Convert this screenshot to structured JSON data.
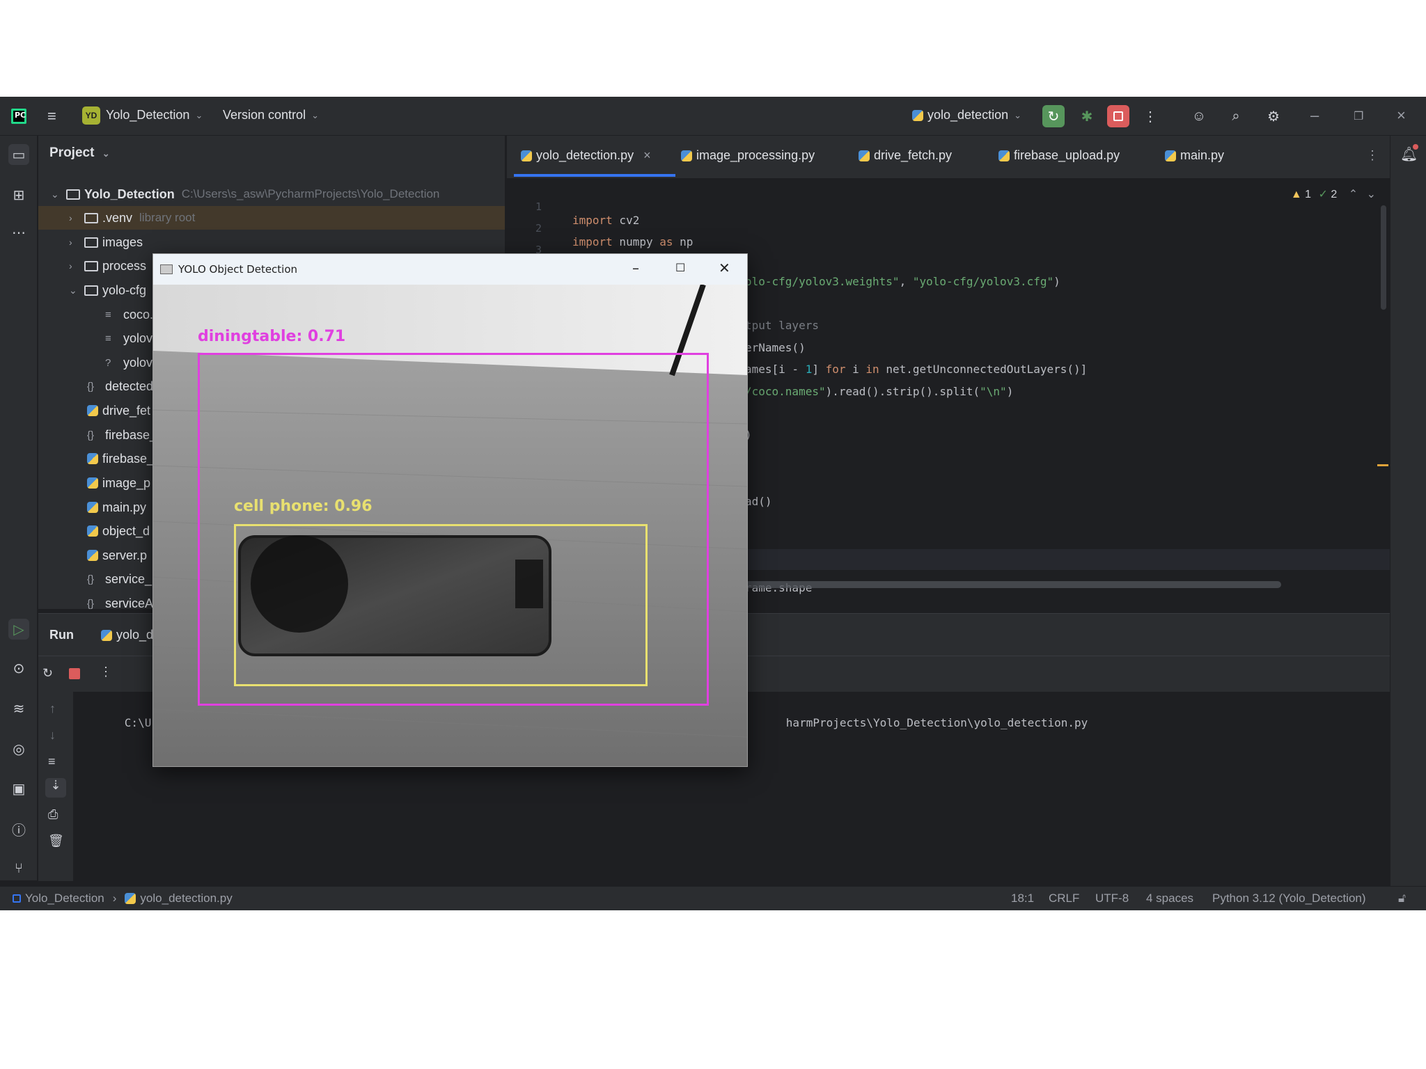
{
  "titlebar": {
    "logo": "PC",
    "project_badge": "YD",
    "project_name": "Yolo_Detection",
    "vcs_label": "Version control",
    "run_config": "yolo_detection"
  },
  "project_panel": {
    "title": "Project",
    "root": {
      "name": "Yolo_Detection",
      "path": "C:\\Users\\s_asw\\PycharmProjects\\Yolo_Detection"
    },
    "items": [
      {
        "name": ".venv",
        "hint": "library root"
      },
      {
        "name": "images"
      },
      {
        "name": "process"
      },
      {
        "name": "yolo-cfg"
      },
      {
        "name": "coco."
      },
      {
        "name": "yolov"
      },
      {
        "name": "yolov"
      },
      {
        "name": "detected"
      },
      {
        "name": "drive_fet"
      },
      {
        "name": "firebase_"
      },
      {
        "name": "firebase_"
      },
      {
        "name": "image_p"
      },
      {
        "name": "main.py"
      },
      {
        "name": "object_d"
      },
      {
        "name": "server.p"
      },
      {
        "name": "service_"
      },
      {
        "name": "serviceA"
      }
    ]
  },
  "tabs": [
    {
      "label": "yolo_detection.py",
      "close": "×"
    },
    {
      "label": "image_processing.py"
    },
    {
      "label": "drive_fetch.py"
    },
    {
      "label": "firebase_upload.py"
    },
    {
      "label": "main.py"
    }
  ],
  "inspections": {
    "warnings": "1",
    "weak": "2"
  },
  "code": {
    "line_numbers": [
      "1",
      "2",
      "3"
    ],
    "l1_kw": "import",
    "l1_rest": " cv2",
    "l2_kw": "import",
    "l2_mid": " numpy ",
    "l2_as": "as",
    "l2_end": " np",
    "l5_str1": "olo-cfg/yolov3.weights\"",
    "l5_comma": ", ",
    "l5_str2": "\"yolo-cfg/yolov3.cfg\"",
    "l5_end": ")",
    "l7_cmt": "tput layers",
    "l8": "erNames()",
    "l9_a": "ames[i - ",
    "l9_num": "1",
    "l9_b": "] ",
    "l9_for": "for",
    "l9_c": " i ",
    "l9_in": "in",
    "l9_d": " net.getUnconnectedOutLayers()]",
    "l10_str": "/coco.names\"",
    "l10_a": ").read().strip().split(",
    "l10_str2": "\"\\n\"",
    "l10_b": ")",
    "l12": ")",
    "l15": "ad()",
    "l19": "rame.shape"
  },
  "run_panel": {
    "title": "Run",
    "tab": "yolo_d",
    "console_left": "C:\\Users\\",
    "console_right": "harmProjects\\Yolo_Detection\\yolo_detection.py"
  },
  "status_bar": {
    "project": "Yolo_Detection",
    "file": "yolo_detection.py",
    "position": "18:1",
    "line_sep": "CRLF",
    "encoding": "UTF-8",
    "indent": "4 spaces",
    "interpreter": "Python 3.12 (Yolo_Detection)"
  },
  "yolo_window": {
    "title": "YOLO Object Detection",
    "detections": [
      {
        "label": "diningtable: 0.71",
        "color": "#e040e0"
      },
      {
        "label": "cell phone: 0.96",
        "color": "#e8e070"
      }
    ]
  },
  "colors": {
    "accent": "#3574f0",
    "run_green": "#57965c",
    "stop_red": "#db5c5c"
  }
}
